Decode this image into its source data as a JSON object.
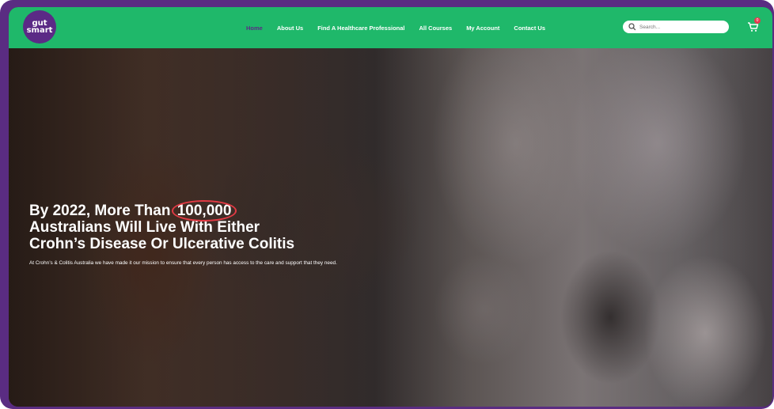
{
  "header": {
    "logo": {
      "line1": "gut",
      "line2": "smart"
    },
    "nav": [
      {
        "label": "Home",
        "active": true
      },
      {
        "label": "About Us"
      },
      {
        "label": "Find A Healthcare Professional"
      },
      {
        "label": "All Courses"
      },
      {
        "label": "My Account"
      },
      {
        "label": "Contact Us"
      }
    ],
    "search": {
      "placeholder": "Search..."
    },
    "cart": {
      "count": "0"
    }
  },
  "hero": {
    "headline": {
      "line1_prefix": "By 2022, More Than ",
      "line1_highlight": "100,000",
      "line2": "Australians Will Live With Either",
      "line3": "Crohn’s Disease Or Ulcerative Colitis"
    },
    "subtext": "At Crohn’s & Colitis Australia we have made it our mission to ensure that every person has access to the care and support that they need."
  },
  "colors": {
    "header_bg": "#1fb86a",
    "brand_purple": "#5b2a86",
    "highlight_circle": "#e13a44",
    "frame": "#5a2c82"
  }
}
